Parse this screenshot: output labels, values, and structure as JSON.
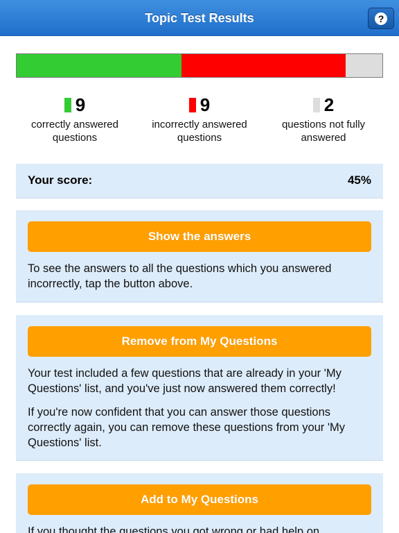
{
  "header": {
    "title": "Topic Test Results",
    "help_button_label": "?"
  },
  "progress": {
    "segments": [
      {
        "name": "correct",
        "fraction": 0.45,
        "color": "#33cc33"
      },
      {
        "name": "incorrect",
        "fraction": 0.45,
        "color": "#ff0000"
      },
      {
        "name": "not-fully-answered",
        "fraction": 0.1,
        "color": "#dddddd"
      }
    ]
  },
  "stats": [
    {
      "count": "9",
      "caption": "correctly answered questions",
      "color": "#33cc33"
    },
    {
      "count": "9",
      "caption": "incorrectly answered questions",
      "color": "#ff0000"
    },
    {
      "count": "2",
      "caption": "questions not fully answered",
      "color": "#dddddd"
    }
  ],
  "score": {
    "label": "Your score:",
    "value": "45%"
  },
  "show_answers": {
    "button_label": "Show the answers",
    "text": "To see the answers to all the questions which you answered incorrectly, tap the button above."
  },
  "remove_from_my_questions": {
    "button_label": "Remove from My Questions",
    "text_1": "Your test included a few questions that are already in your 'My Questions' list, and you've just now answered them correctly!",
    "text_2": "If you're now confident that you can answer those questions correctly again, you can remove these questions from your 'My Questions' list."
  },
  "add_to_my_questions": {
    "button_label": "Add to My Questions",
    "text": "If you thought the questions you got wrong or had help on"
  },
  "colors": {
    "nav_bar": "#2a7ad6",
    "panel_background": "#ddecfa",
    "action_button": "#ff9f00"
  }
}
